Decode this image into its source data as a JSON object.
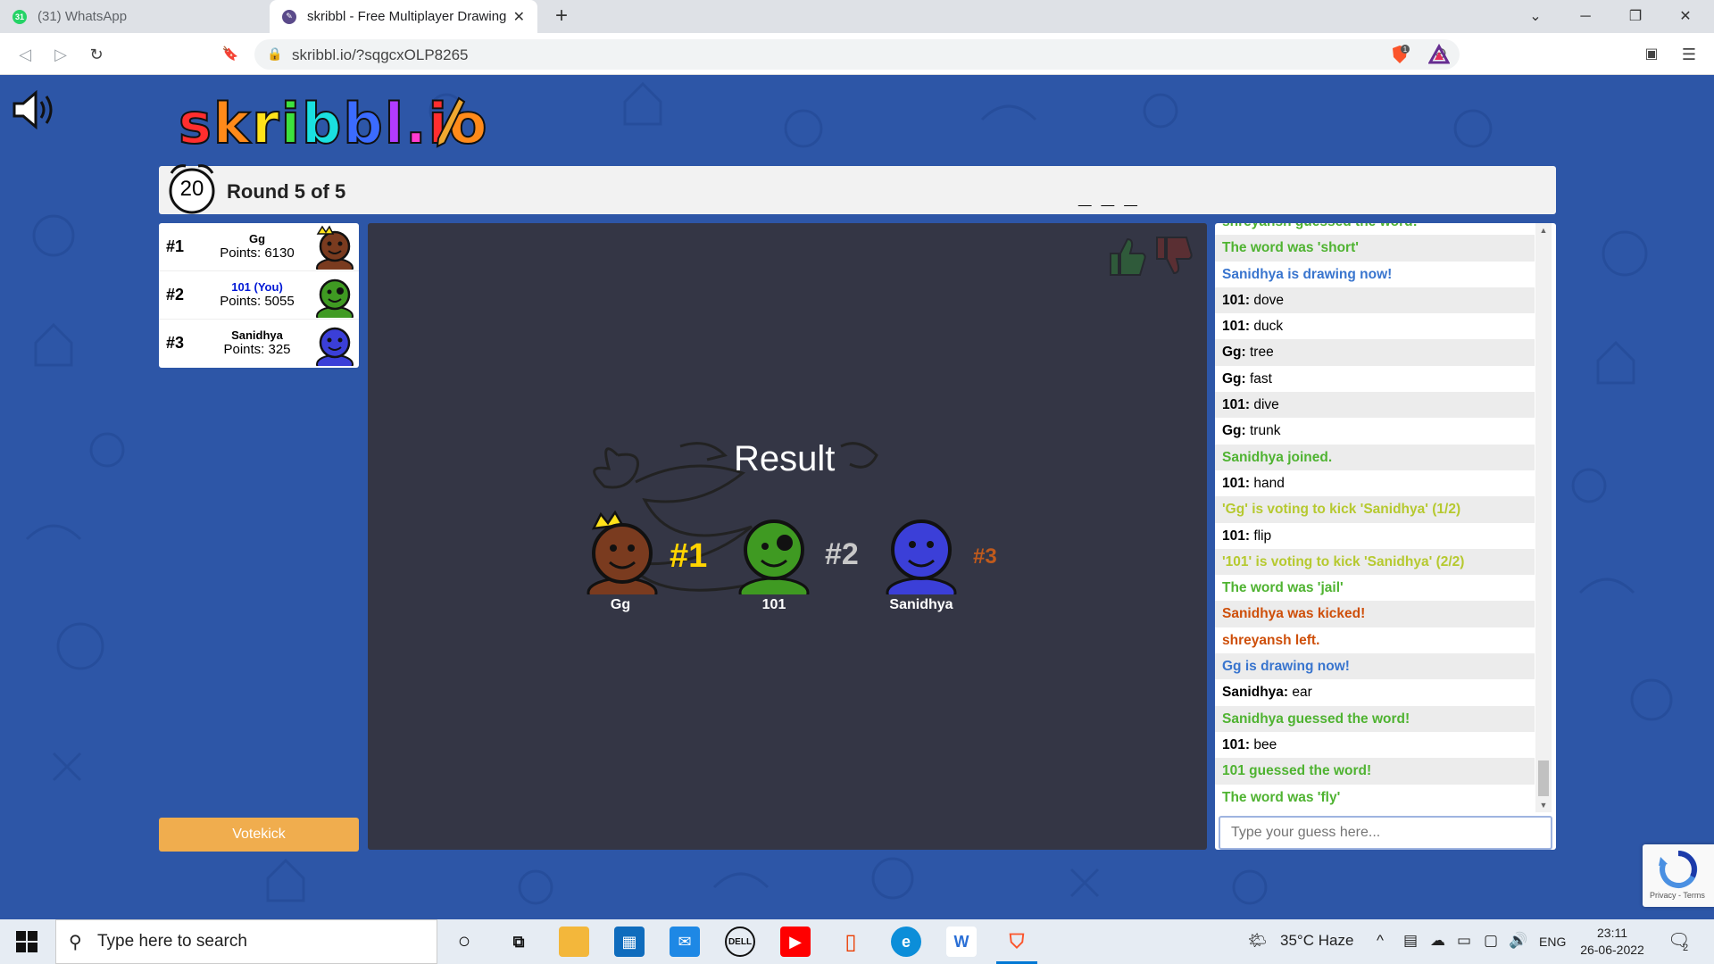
{
  "browser": {
    "tabs": [
      {
        "title": "(31) WhatsApp",
        "favicon_color": "#25d366",
        "badge": "31"
      },
      {
        "title": "skribbl - Free Multiplayer Drawing",
        "favicon_color": "#5a4a8a",
        "close": "✕"
      }
    ],
    "new_tab": "+",
    "window_controls": {
      "dropdown": "⌄",
      "minimize": "─",
      "maximize": "❐",
      "close": "✕"
    },
    "nav": {
      "back": "◁",
      "forward": "▷",
      "reload": "↻",
      "bookmark": "🔖"
    },
    "url": "skribbl.io/?sqgcxOLP8265",
    "brave_badge": "1"
  },
  "game": {
    "logo": "skribbl.io",
    "timer": "20",
    "round": "Round 5 of 5",
    "word_hint": "_ _ _",
    "players": [
      {
        "rank": "#1",
        "name": "Gg",
        "points": "Points: 6130",
        "color": "#7a3b1f",
        "crown": true,
        "you": false
      },
      {
        "rank": "#2",
        "name": "101 (You)",
        "points": "Points: 5055",
        "color": "#3f9a22",
        "crown": false,
        "you": true
      },
      {
        "rank": "#3",
        "name": "Sanidhya",
        "points": "Points: 325",
        "color": "#3b3fd8",
        "crown": false,
        "you": false
      }
    ],
    "votekick_label": "Votekick",
    "result": {
      "title": "Result",
      "podium": [
        {
          "rank": "#1",
          "name": "Gg",
          "color": "#7a3b1f",
          "rank_color": "#ffd400"
        },
        {
          "rank": "#2",
          "name": "101",
          "color": "#3f9a22",
          "rank_color": "#c8c8c8"
        },
        {
          "rank": "#3",
          "name": "Sanidhya",
          "color": "#3b3fd8",
          "rank_color": "#c05a1c"
        }
      ]
    },
    "chat": {
      "messages": [
        {
          "text": "shreyansh guessed the word!",
          "color": "#4fb331"
        },
        {
          "text": "The word was 'short'",
          "color": "#4fb331"
        },
        {
          "text": "Sanidhya is drawing now!",
          "color": "#3975ce"
        },
        {
          "nick": "101:",
          "text": "dove"
        },
        {
          "nick": "101:",
          "text": "duck"
        },
        {
          "nick": "Gg:",
          "text": "tree"
        },
        {
          "nick": "Gg:",
          "text": "fast"
        },
        {
          "nick": "101:",
          "text": "dive"
        },
        {
          "nick": "Gg:",
          "text": "trunk"
        },
        {
          "text": "Sanidhya joined.",
          "color": "#4fb331"
        },
        {
          "nick": "101:",
          "text": "hand"
        },
        {
          "text": "'Gg' is voting to kick 'Sanidhya' (1/2)",
          "color": "#b6c92f"
        },
        {
          "nick": "101:",
          "text": "flip"
        },
        {
          "text": "'101' is voting to kick 'Sanidhya' (2/2)",
          "color": "#b6c92f"
        },
        {
          "text": "The word was 'jail'",
          "color": "#4fb331"
        },
        {
          "text": "Sanidhya was kicked!",
          "color": "#ce4f0a"
        },
        {
          "text": "shreyansh left.",
          "color": "#ce4f0a"
        },
        {
          "text": "Gg is drawing now!",
          "color": "#3975ce"
        },
        {
          "nick": "Sanidhya:",
          "text": "ear"
        },
        {
          "text": "Sanidhya guessed the word!",
          "color": "#4fb331"
        },
        {
          "nick": "101:",
          "text": "bee"
        },
        {
          "text": "101 guessed the word!",
          "color": "#4fb331"
        },
        {
          "text": "The word was 'fly'",
          "color": "#4fb331"
        }
      ],
      "input_placeholder": "Type your guess here..."
    },
    "recaptcha_label": "Privacy - Terms"
  },
  "taskbar": {
    "search_placeholder": "Type here to search",
    "weather": "35°C  Haze",
    "language": "ENG",
    "time": "23:11",
    "date": "26-06-2022",
    "notifications": "2"
  }
}
